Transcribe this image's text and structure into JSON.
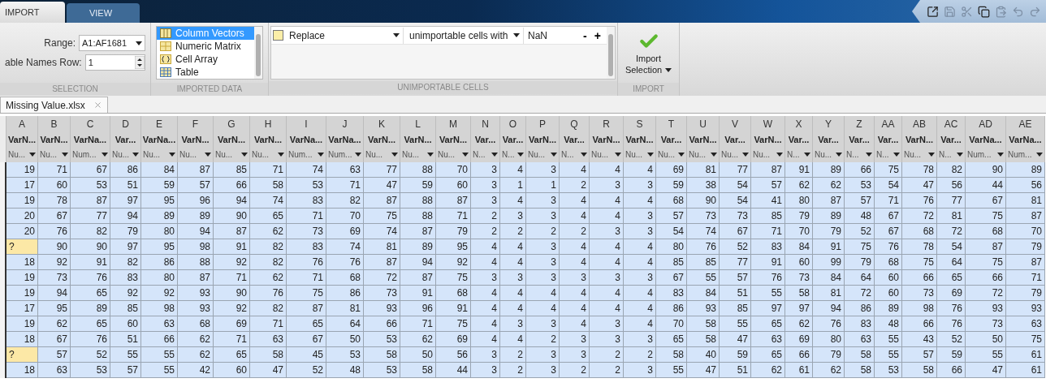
{
  "tabs": [
    {
      "label": "IMPORT",
      "selected": true
    },
    {
      "label": "VIEW",
      "selected": false
    }
  ],
  "selection": {
    "title": "SELECTION",
    "range_label": "Range:",
    "range_value": "A1:AF1681",
    "names_row_label": "able Names Row:",
    "names_row_value": "1"
  },
  "imported_data": {
    "title": "IMPORTED DATA",
    "options": [
      {
        "label": "Column Vectors",
        "kind": "columns",
        "selected": true
      },
      {
        "label": "Numeric Matrix",
        "kind": "matrix",
        "selected": false
      },
      {
        "label": "Cell Array",
        "kind": "cell",
        "selected": false
      },
      {
        "label": "Table",
        "kind": "table",
        "selected": false
      }
    ]
  },
  "unimportable_cells": {
    "title": "UNIMPORTABLE CELLS",
    "rules": [
      {
        "action": "Replace",
        "target": "unimportable cells with",
        "value": "NaN",
        "remove": "-",
        "add": "+"
      }
    ]
  },
  "import": {
    "title": "IMPORT",
    "button_lines": [
      "Import",
      "Selection"
    ]
  },
  "document_tab": {
    "title": "Missing Value.xlsx"
  },
  "table": {
    "columns": [
      {
        "letter": "A",
        "name": "VarN...",
        "type": "Nu..."
      },
      {
        "letter": "B",
        "name": "VarN...",
        "type": "Nu..."
      },
      {
        "letter": "C",
        "name": "VarNa...",
        "type": "Num..."
      },
      {
        "letter": "D",
        "name": "Var...",
        "type": "Nu..."
      },
      {
        "letter": "E",
        "name": "VarNa...",
        "type": "Nu..."
      },
      {
        "letter": "F",
        "name": "VarN...",
        "type": "Nu..."
      },
      {
        "letter": "G",
        "name": "VarN...",
        "type": "Nu..."
      },
      {
        "letter": "H",
        "name": "VarN...",
        "type": "Nu..."
      },
      {
        "letter": "I",
        "name": "VarNa...",
        "type": "Num..."
      },
      {
        "letter": "J",
        "name": "VarNa...",
        "type": "Num..."
      },
      {
        "letter": "K",
        "name": "VarN...",
        "type": "Nu..."
      },
      {
        "letter": "L",
        "name": "VarN...",
        "type": "Nu..."
      },
      {
        "letter": "M",
        "name": "VarN...",
        "type": "Nu..."
      },
      {
        "letter": "N",
        "name": "Var...",
        "type": "N..."
      },
      {
        "letter": "O",
        "name": "Var...",
        "type": "N..."
      },
      {
        "letter": "P",
        "name": "VarN...",
        "type": "Nu..."
      },
      {
        "letter": "Q",
        "name": "Var...",
        "type": "N..."
      },
      {
        "letter": "R",
        "name": "VarN...",
        "type": "Nu..."
      },
      {
        "letter": "S",
        "name": "VarN...",
        "type": "Nu..."
      },
      {
        "letter": "T",
        "name": "Var...",
        "type": "Nu..."
      },
      {
        "letter": "U",
        "name": "VarN...",
        "type": "Nu..."
      },
      {
        "letter": "V",
        "name": "Var...",
        "type": "Nu..."
      },
      {
        "letter": "W",
        "name": "VarN...",
        "type": "Nu..."
      },
      {
        "letter": "X",
        "name": "Var...",
        "type": "N..."
      },
      {
        "letter": "Y",
        "name": "Var...",
        "type": "Nu..."
      },
      {
        "letter": "Z",
        "name": "Var...",
        "type": "N..."
      },
      {
        "letter": "AA",
        "name": "Var...",
        "type": "N..."
      },
      {
        "letter": "AB",
        "name": "VarN...",
        "type": "Nu..."
      },
      {
        "letter": "AC",
        "name": "Var...",
        "type": "N..."
      },
      {
        "letter": "AD",
        "name": "VarNa...",
        "type": "Num..."
      },
      {
        "letter": "AE",
        "name": "VarNa...",
        "type": "Num..."
      }
    ],
    "rows": [
      [
        "19",
        "71",
        "67",
        "86",
        "84",
        "87",
        "85",
        "71",
        "74",
        "63",
        "77",
        "88",
        "70",
        "3",
        "4",
        "3",
        "4",
        "4",
        "4",
        "69",
        "81",
        "77",
        "87",
        "91",
        "89",
        "66",
        "75",
        "78",
        "82",
        "90",
        "89"
      ],
      [
        "17",
        "60",
        "53",
        "51",
        "59",
        "57",
        "66",
        "58",
        "53",
        "71",
        "47",
        "59",
        "60",
        "3",
        "1",
        "1",
        "2",
        "3",
        "3",
        "59",
        "38",
        "54",
        "57",
        "62",
        "62",
        "53",
        "54",
        "47",
        "56",
        "44",
        "56"
      ],
      [
        "19",
        "78",
        "87",
        "97",
        "95",
        "96",
        "94",
        "74",
        "83",
        "82",
        "87",
        "88",
        "87",
        "3",
        "4",
        "3",
        "4",
        "4",
        "4",
        "68",
        "90",
        "54",
        "41",
        "80",
        "87",
        "57",
        "71",
        "76",
        "77",
        "67",
        "81"
      ],
      [
        "20",
        "67",
        "77",
        "94",
        "89",
        "89",
        "90",
        "65",
        "71",
        "70",
        "75",
        "88",
        "71",
        "2",
        "3",
        "3",
        "4",
        "4",
        "3",
        "57",
        "73",
        "73",
        "85",
        "79",
        "89",
        "48",
        "67",
        "72",
        "81",
        "75",
        "87"
      ],
      [
        "20",
        "76",
        "82",
        "79",
        "80",
        "94",
        "87",
        "62",
        "73",
        "69",
        "74",
        "87",
        "79",
        "2",
        "2",
        "2",
        "2",
        "3",
        "3",
        "54",
        "74",
        "67",
        "71",
        "70",
        "79",
        "52",
        "67",
        "68",
        "72",
        "68",
        "70"
      ],
      [
        {
          "text": "?",
          "unimportable": true
        },
        "90",
        "90",
        "97",
        "95",
        "98",
        "91",
        "82",
        "83",
        "74",
        "81",
        "89",
        "95",
        "4",
        "4",
        "3",
        "4",
        "4",
        "4",
        "80",
        "76",
        "52",
        "83",
        "84",
        "91",
        "75",
        "76",
        "78",
        "54",
        "87",
        "79"
      ],
      [
        "18",
        "92",
        "91",
        "82",
        "86",
        "88",
        "92",
        "82",
        "76",
        "76",
        "87",
        "94",
        "92",
        "4",
        "4",
        "3",
        "4",
        "4",
        "4",
        "85",
        "85",
        "77",
        "91",
        "60",
        "99",
        "79",
        "68",
        "75",
        "64",
        "75",
        "87"
      ],
      [
        "19",
        "73",
        "76",
        "83",
        "80",
        "87",
        "71",
        "62",
        "71",
        "68",
        "72",
        "87",
        "75",
        "3",
        "3",
        "3",
        "3",
        "3",
        "3",
        "67",
        "55",
        "57",
        "76",
        "73",
        "84",
        "64",
        "60",
        "66",
        "65",
        "66",
        "71"
      ],
      [
        "19",
        "94",
        "65",
        "92",
        "92",
        "93",
        "90",
        "76",
        "75",
        "86",
        "73",
        "91",
        "68",
        "4",
        "4",
        "4",
        "4",
        "4",
        "4",
        "83",
        "84",
        "51",
        "55",
        "58",
        "81",
        "72",
        "60",
        "73",
        "69",
        "72",
        "79"
      ],
      [
        "17",
        "95",
        "89",
        "85",
        "98",
        "93",
        "92",
        "82",
        "87",
        "81",
        "93",
        "96",
        "91",
        "4",
        "4",
        "4",
        "4",
        "4",
        "4",
        "86",
        "93",
        "85",
        "97",
        "97",
        "94",
        "86",
        "89",
        "98",
        "76",
        "93",
        "93"
      ],
      [
        "19",
        "62",
        "65",
        "60",
        "63",
        "68",
        "69",
        "71",
        "65",
        "64",
        "66",
        "71",
        "75",
        "4",
        "3",
        "3",
        "4",
        "3",
        "4",
        "70",
        "58",
        "55",
        "65",
        "62",
        "76",
        "83",
        "48",
        "66",
        "76",
        "73",
        "63"
      ],
      [
        "18",
        "67",
        "76",
        "51",
        "66",
        "62",
        "71",
        "63",
        "67",
        "50",
        "53",
        "62",
        "69",
        "4",
        "4",
        "2",
        "3",
        "3",
        "3",
        "65",
        "58",
        "47",
        "63",
        "69",
        "80",
        "63",
        "55",
        "43",
        "52",
        "50",
        "75"
      ],
      [
        {
          "text": "?",
          "unimportable": true
        },
        "57",
        "52",
        "55",
        "55",
        "62",
        "65",
        "58",
        "45",
        "53",
        "58",
        "50",
        "56",
        "3",
        "2",
        "3",
        "3",
        "2",
        "2",
        "58",
        "40",
        "59",
        "65",
        "66",
        "79",
        "58",
        "55",
        "57",
        "59",
        "55",
        "61"
      ],
      [
        "18",
        "63",
        "53",
        "57",
        "55",
        "42",
        "60",
        "47",
        "52",
        "48",
        "53",
        "58",
        "44",
        "3",
        "2",
        "3",
        "2",
        "2",
        "3",
        "55",
        "47",
        "51",
        "62",
        "61",
        "62",
        "58",
        "53",
        "58",
        "66",
        "47",
        "61"
      ]
    ]
  }
}
